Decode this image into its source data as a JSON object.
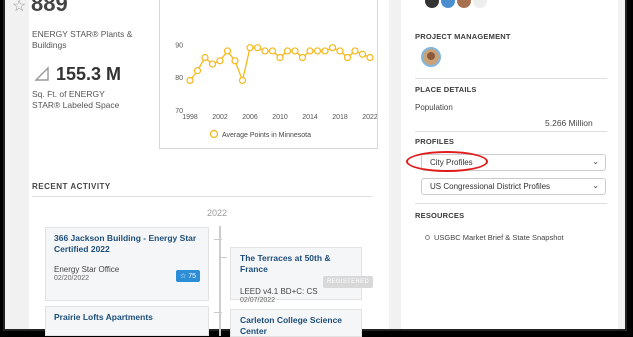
{
  "stats": {
    "plants_count": "889",
    "plants_label": "ENERGY STAR® Plants & Buildings",
    "sqft_value": "155.3 M",
    "sqft_label": "Sq. Ft. of ENERGY STAR® Labeled Space"
  },
  "chart_data": {
    "type": "line",
    "x": [
      1998,
      1999,
      2000,
      2001,
      2002,
      2003,
      2004,
      2005,
      2006,
      2007,
      2008,
      2009,
      2010,
      2011,
      2012,
      2013,
      2014,
      2015,
      2016,
      2017,
      2018,
      2019,
      2020,
      2021,
      2022
    ],
    "series": [
      {
        "name": "Average Points in Minnesota",
        "values": [
          79,
          82,
          86,
          84,
          85,
          88,
          85,
          79,
          89,
          89,
          88,
          88,
          86,
          88,
          88,
          86,
          88,
          88,
          88,
          89,
          88,
          86,
          88,
          87,
          86
        ]
      }
    ],
    "xticks": [
      "1998",
      "2002",
      "2006",
      "2010",
      "2014",
      "2018",
      "2022"
    ],
    "yticks": [
      "70",
      "80",
      "90"
    ],
    "ylim": [
      70,
      95
    ],
    "color": "#f5b81b",
    "legend": "Average Points in Minnesota"
  },
  "recent": {
    "title": "RECENT ACTIVITY",
    "year": "2022",
    "cards": [
      {
        "title": "366 Jackson Building - Energy Star Certified 2022",
        "sub": "Energy Star Office",
        "date": "02/20/2022",
        "badge": "☆ 75"
      },
      {
        "title": "The Terraces at 50th & France",
        "sub": "LEED v4.1 BD+C: CS",
        "date": "02/07/2022",
        "badge": "REGISTERED"
      },
      {
        "title": "Prairie Lofts Apartments",
        "sub": "",
        "date": "",
        "badge": ""
      },
      {
        "title": "Carleton College Science Center",
        "sub": "",
        "date": "",
        "badge": ""
      }
    ]
  },
  "right": {
    "project_mgmt": "PROJECT MANAGEMENT",
    "place_details": "PLACE DETAILS",
    "population_label": "Population",
    "population_value": "5.266 Million",
    "profiles": "PROFILES",
    "select1": "City Profiles",
    "select2": "US Congressional District Profiles",
    "resources": "RESOURCES",
    "resource1": "USGBC Market Brief & State Snapshot"
  },
  "colors": {
    "accent": "#f5b81b",
    "link": "#1d4e7a",
    "annotation": "#e01b1b"
  }
}
